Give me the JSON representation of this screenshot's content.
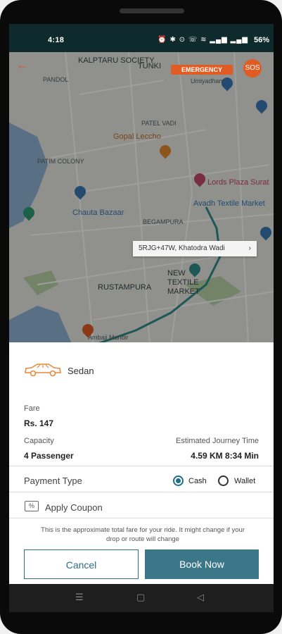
{
  "status": {
    "time": "4:18",
    "icons": "⏰ ✱ ⊙ ☏ ≋ ▂▄▆ ▂▄▆",
    "battery": "56%"
  },
  "map": {
    "labels": [
      "KALPTARU SOCIETY",
      "TUNKI",
      "Umiyadham",
      "PANDOL",
      "PATEL VADI",
      "Gopal Leccho",
      "PATIM COLONY",
      "Lords Plaza Surat",
      "Avadh Textile Market",
      "Chauta Bazaar",
      "BEGAMPURA",
      "RUSTAMPURA",
      "NEW TEXTILE MARKET",
      "Ambaji Mandir"
    ],
    "emergency_label": "EMERGENCY",
    "sos_label": "SOS",
    "address_chip": "5RJG+47W, Khatodra Wadi",
    "back_icon": "back-arrow-icon"
  },
  "ride": {
    "vehicle": "Sedan",
    "fare_label": "Fare",
    "fare_value": "Rs. 147",
    "capacity_label": "Capacity",
    "capacity_value": "4 Passenger",
    "journey_label": "Estimated Journey Time",
    "journey_value": "4.59 KM 8:34 Min"
  },
  "payment": {
    "label": "Payment Type",
    "options": [
      {
        "label": "Cash",
        "selected": true
      },
      {
        "label": "Wallet",
        "selected": false
      }
    ]
  },
  "coupon": {
    "label": "Apply Coupon"
  },
  "note": "This is the approximate total fare for your ride. It might change if your drop or route will change",
  "buttons": {
    "cancel": "Cancel",
    "book": "Book Now"
  },
  "navbar": {
    "menu_icon": "menu-icon",
    "home_icon": "home-icon",
    "back_icon": "back-icon"
  },
  "colors": {
    "accent": "#3c7689",
    "brand_orange": "#e05c22",
    "status_bar": "#0f2a2d"
  }
}
